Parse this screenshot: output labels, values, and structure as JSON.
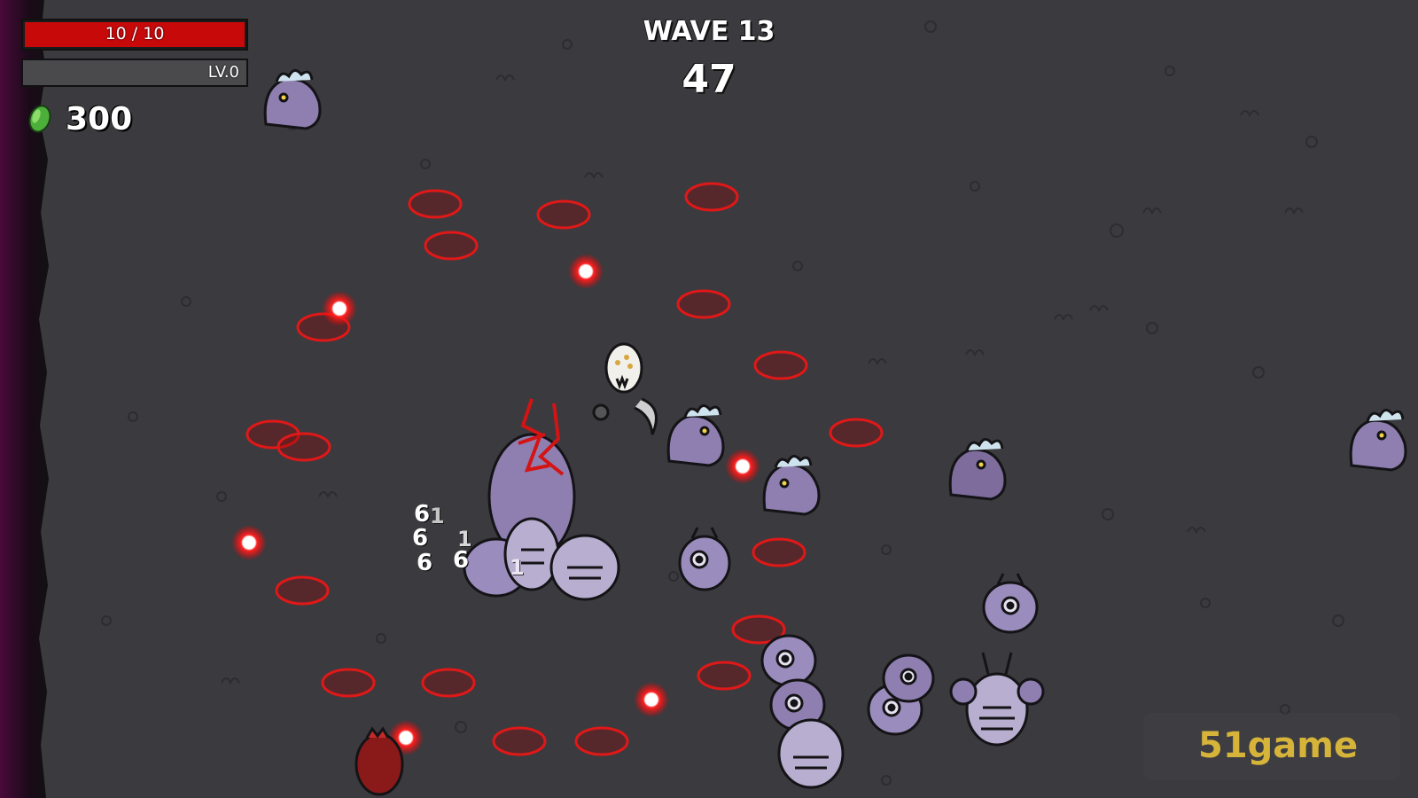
{
  "hud": {
    "health": {
      "text": "10 / 10",
      "current": 10,
      "max": 10,
      "fill_fraction": 1.0,
      "color": "#c8090a"
    },
    "experience": {
      "text": "LV.0",
      "fill_fraction": 0.0,
      "color": "#3dbb3d"
    },
    "materials": {
      "value": "300",
      "icon": "green-material-icon",
      "color": "#4caf3a"
    },
    "wave": {
      "title": "WAVE 13",
      "timer": "47"
    }
  },
  "combat": {
    "damage_numbers": [
      "6",
      "1",
      "6",
      "1",
      "6",
      "6",
      "1"
    ],
    "projectile_color": "#ff1a1a",
    "spawn_marker_color": "#d41414"
  },
  "watermark": {
    "text": "51game",
    "color": "#d6b43a"
  }
}
